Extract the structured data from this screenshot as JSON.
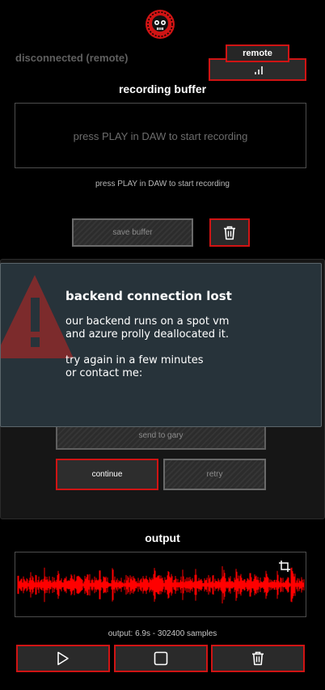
{
  "header": {
    "logo_icon": "skull-logo-icon",
    "connection_status": "disconnected (remote)",
    "remote_label": "remote",
    "signal_icon": "signal-bars-icon"
  },
  "recording": {
    "title": "recording buffer",
    "placeholder": "press PLAY in DAW to start recording",
    "hint": "press PLAY in DAW to start recording",
    "save_label": "save buffer",
    "delete_icon": "trash-icon"
  },
  "actions": {
    "send_label": "send to gary",
    "continue_label": "continue",
    "retry_label": "retry"
  },
  "error_toast": {
    "icon": "warning-triangle-icon",
    "title": "backend connection lost",
    "line1": "our backend runs on a spot vm",
    "line2": "and azure prolly deallocated it.",
    "line3": "try again in a few minutes",
    "line4": "or contact me:"
  },
  "output": {
    "title": "output",
    "crop_icon": "crop-icon",
    "info": "output: 6.9s - 302400 samples",
    "play_icon": "play-icon",
    "stop_icon": "stop-icon",
    "delete_icon": "trash-icon"
  },
  "colors": {
    "accent": "#d01414",
    "background": "#000000",
    "panel": "#161616",
    "toast_bg": "#27333a",
    "waveform": "#ff0000"
  }
}
